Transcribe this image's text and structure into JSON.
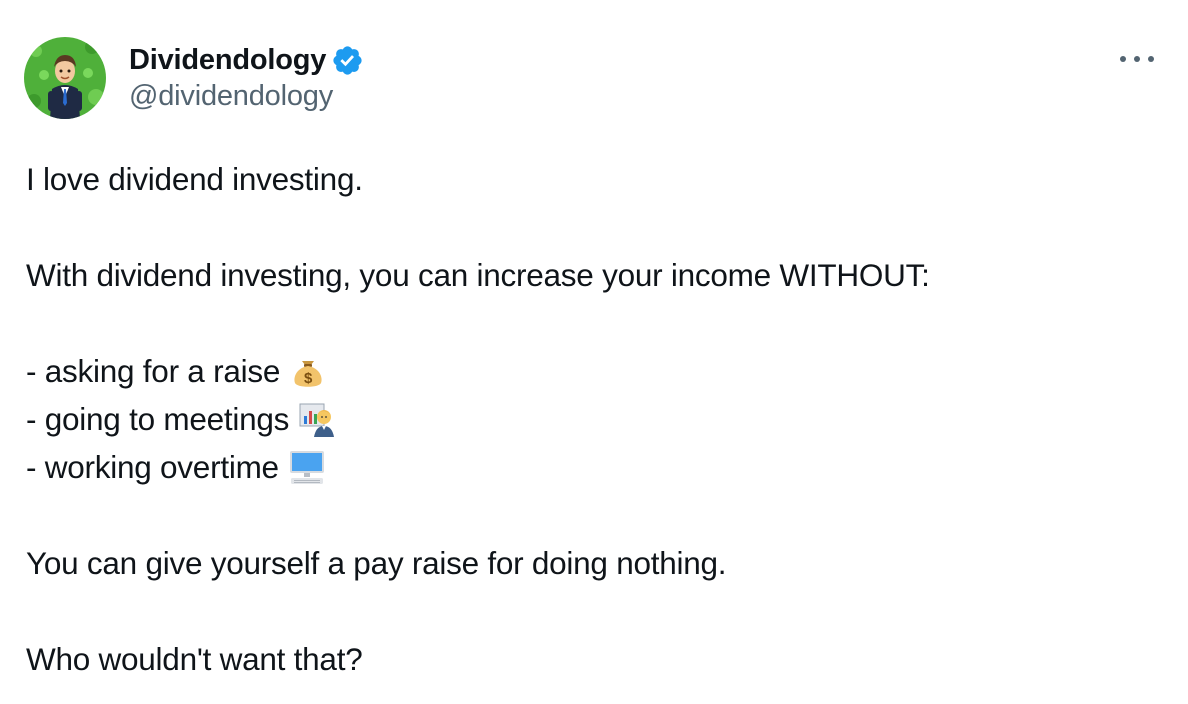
{
  "author": {
    "display_name": "Dividendology",
    "handle": "@dividendology",
    "verified_icon": "verified-badge-icon",
    "avatar": "avatar-businessman-on-green-money-background"
  },
  "menu": {
    "icon": "more-options-icon"
  },
  "body": {
    "line1": "I love dividend investing.",
    "line2": "With dividend investing, you can increase your income WITHOUT:",
    "bullets": [
      {
        "text": "- asking for a raise",
        "emoji": "money-bag-icon"
      },
      {
        "text": "- going to meetings",
        "emoji": "office-worker-icon"
      },
      {
        "text": "- working overtime",
        "emoji": "desktop-computer-icon"
      }
    ],
    "line3": "You can give yourself a pay raise for doing nothing.",
    "line4": "Who wouldn't want that?"
  },
  "colors": {
    "text": "#0f1419",
    "secondary": "#536471",
    "verified": "#1d9bf0"
  }
}
